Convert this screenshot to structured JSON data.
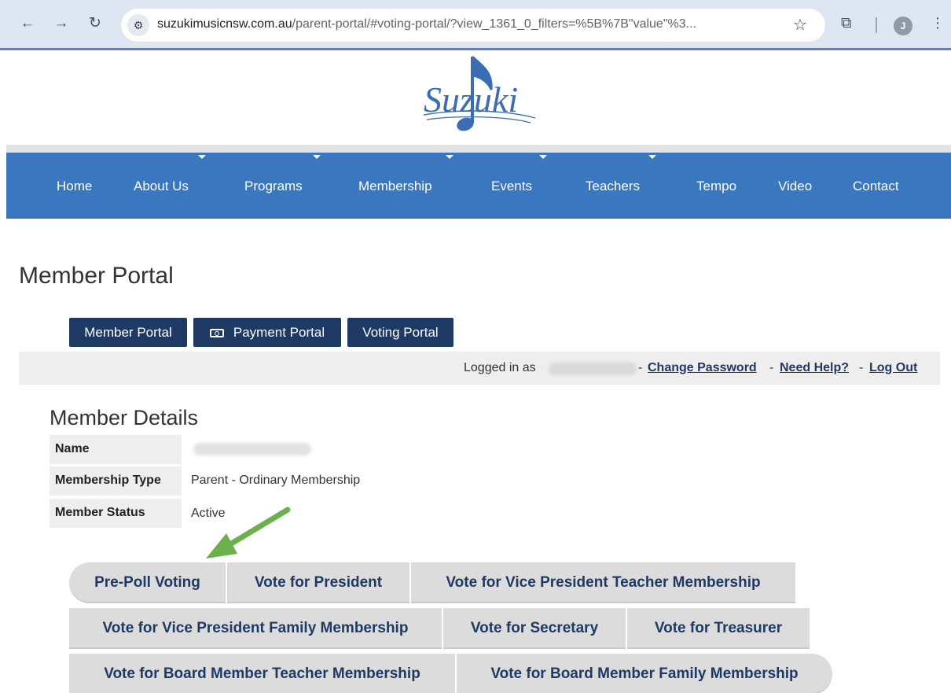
{
  "browser": {
    "url_host": "suzukimusicnsw.com.au",
    "url_path": "/parent-portal/#voting-portal/?view_1361_0_filters=%5B%7B\"value\"%3...",
    "profile_initial": "J",
    "icons": {
      "back": "back-arrow-icon",
      "forward": "forward-arrow-icon",
      "reload": "reload-icon",
      "site_info": "site-info-icon",
      "bookmark": "star-icon",
      "extensions": "puzzle-icon",
      "menu": "kebab-menu-icon"
    }
  },
  "header": {
    "logo_alt": "Suzuki"
  },
  "nav": {
    "items": [
      {
        "label": "Home"
      },
      {
        "label": "About Us"
      },
      {
        "label": "Programs"
      },
      {
        "label": "Membership"
      },
      {
        "label": "Events"
      },
      {
        "label": "Teachers"
      },
      {
        "label": "Tempo"
      },
      {
        "label": "Video"
      },
      {
        "label": "Contact"
      }
    ]
  },
  "page": {
    "title": "Member Portal",
    "tabs": [
      {
        "label": "Member Portal"
      },
      {
        "label": "Payment Portal",
        "icon": "cash-icon"
      },
      {
        "label": "Voting Portal"
      }
    ]
  },
  "login_bar": {
    "logged_in_label": "Logged in as",
    "separator": "-",
    "change_password": "Change Password",
    "need_help": "Need Help?",
    "log_out": "Log Out"
  },
  "member_details": {
    "title": "Member Details",
    "rows": [
      {
        "label": "Name",
        "value": ""
      },
      {
        "label": "Membership Type",
        "value": "Parent - Ordinary Membership"
      },
      {
        "label": "Member Status",
        "value": "Active"
      }
    ]
  },
  "annotation": {
    "arrow_color": "#6ab04c"
  },
  "voting_buttons": [
    {
      "label": "Pre-Poll Voting"
    },
    {
      "label": "Vote for President"
    },
    {
      "label": "Vote for Vice President Teacher Membership"
    },
    {
      "label": "Vote for Vice President Family Membership"
    },
    {
      "label": "Vote for Secretary"
    },
    {
      "label": "Vote for Treasurer"
    },
    {
      "label": "Vote for Board Member Teacher Membership"
    },
    {
      "label": "Vote for Board Member Family Membership"
    }
  ],
  "colors": {
    "nav_blue": "#3b77bf",
    "dark_navy": "#1e3a64",
    "button_gray": "#dcdcdc"
  }
}
